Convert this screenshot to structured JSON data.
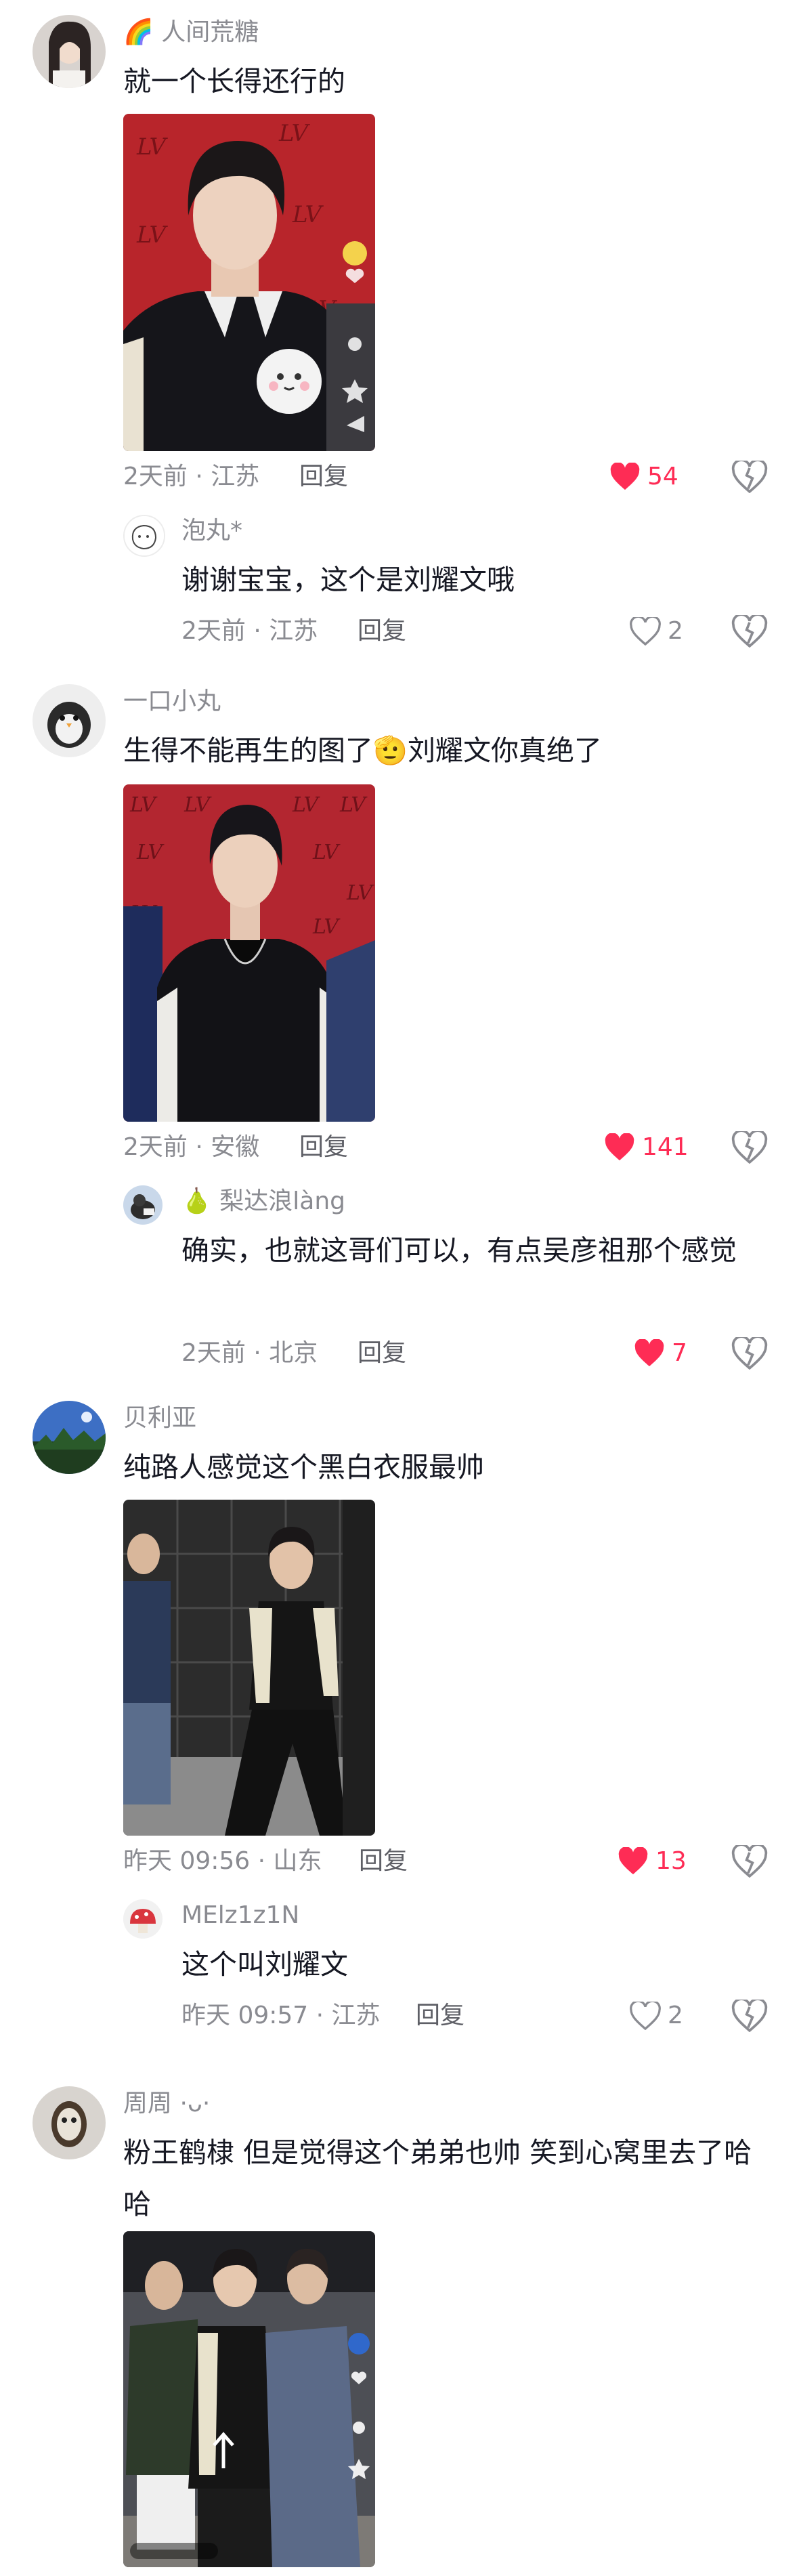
{
  "comments": [
    {
      "username": "人间荒糖",
      "username_badge": "🌈",
      "text": "就一个长得还行的",
      "time_loc": "2天前 · 江苏",
      "reply_label": "回复",
      "likes": "54",
      "liked": true,
      "reply": {
        "username": "泡丸*",
        "text": "谢谢宝宝，这个是刘耀文哦",
        "time_loc": "2天前 · 江苏",
        "reply_label": "回复",
        "likes": "2",
        "liked": false
      }
    },
    {
      "username": "一口小丸",
      "text": "生得不能再生的图了🫡刘耀文你真绝了",
      "time_loc": "2天前 · 安徽",
      "reply_label": "回复",
      "likes": "141",
      "liked": true,
      "reply": {
        "username": "梨达浪làng",
        "username_badge": "🍐",
        "text": "确实，也就这哥们可以，有点吴彦祖那个感觉",
        "time_loc": "2天前 · 北京",
        "reply_label": "回复",
        "likes": "7",
        "liked": true
      }
    },
    {
      "username": "贝利亚",
      "text": "纯路人感觉这个黑白衣服最帅",
      "time_loc": "昨天 09:56 · 山东",
      "reply_label": "回复",
      "likes": "13",
      "liked": true,
      "reply": {
        "username": "MElz1z1N",
        "text": "这个叫刘耀文",
        "time_loc": "昨天 09:57 · 江苏",
        "reply_label": "回复",
        "likes": "2",
        "liked": false
      }
    },
    {
      "username": "周周 ·ᴗ·",
      "text": "粉王鹤棣 但是觉得这个弟弟也帅 笑到心窝里去了哈哈"
    }
  ],
  "colors": {
    "liked": "#fe2c55",
    "muted": "#8a8b91",
    "text": "#161823"
  }
}
